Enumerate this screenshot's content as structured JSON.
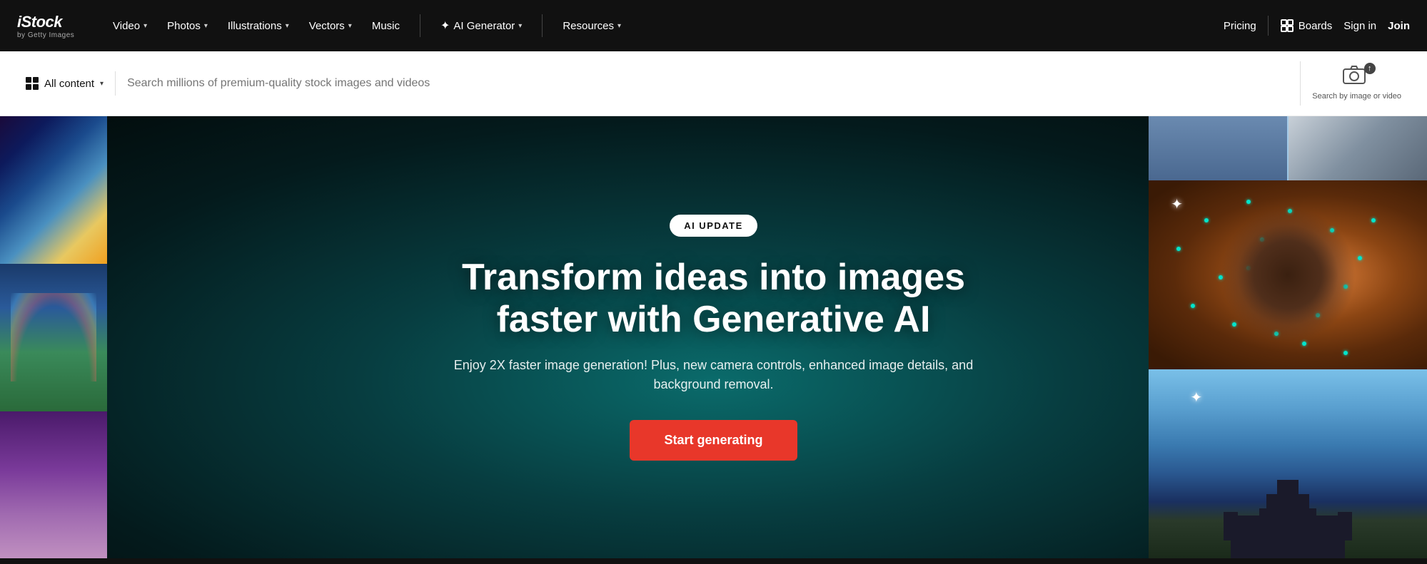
{
  "brand": {
    "name": "iStock",
    "sub": "by Getty Images"
  },
  "nav": {
    "items": [
      {
        "label": "Video",
        "hasDropdown": true
      },
      {
        "label": "Photos",
        "hasDropdown": true
      },
      {
        "label": "Illustrations",
        "hasDropdown": true
      },
      {
        "label": "Vectors",
        "hasDropdown": true
      },
      {
        "label": "Music",
        "hasDropdown": false
      },
      {
        "label": "AI Generator",
        "hasDropdown": true,
        "hasSparkle": true
      },
      {
        "label": "Resources",
        "hasDropdown": true
      }
    ],
    "right": {
      "pricing": "Pricing",
      "boards": "Boards",
      "signIn": "Sign in",
      "join": "Join"
    }
  },
  "search": {
    "filterLabel": "All content",
    "placeholder": "Search millions of premium-quality stock images and videos",
    "imageSearchLabel": "Search by image\nor video"
  },
  "hero": {
    "badge": "AI UPDATE",
    "title": "Transform ideas into images faster with Generative AI",
    "subtitle": "Enjoy 2X faster image generation! Plus, new camera controls, enhanced image details, and background removal.",
    "cta": "Start generating"
  }
}
